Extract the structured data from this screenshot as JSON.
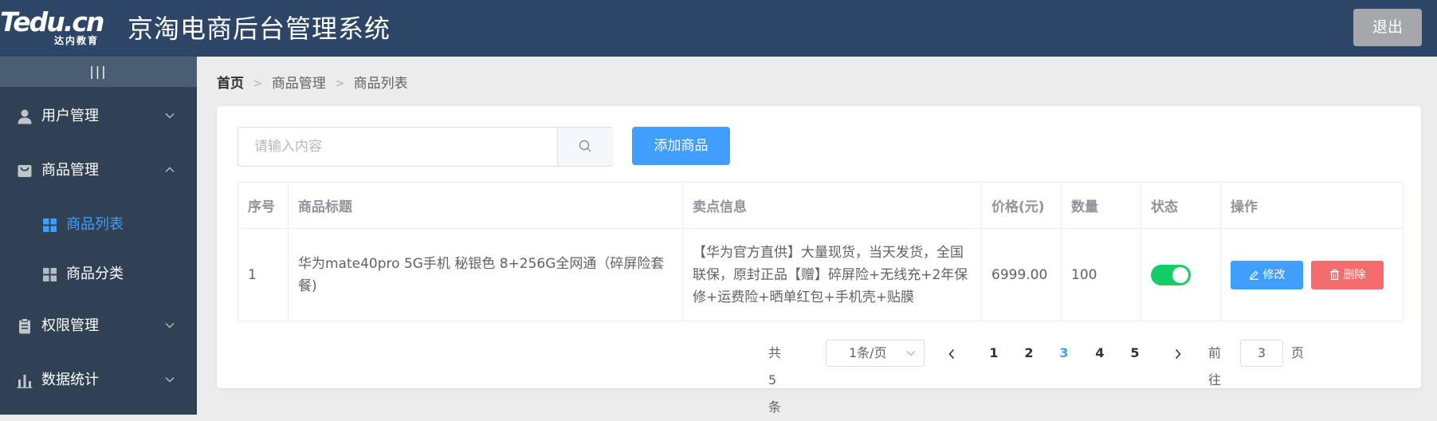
{
  "header": {
    "logo_main": "Tedu.cn",
    "logo_sub": "达内教育",
    "title": "京淘电商后台管理系统",
    "logout": "退出"
  },
  "sidebar": {
    "toggle": "|||",
    "active_color": "#409eff",
    "menus": [
      {
        "label": "用户管理",
        "icon": "user-icon",
        "expanded": false
      },
      {
        "label": "商品管理",
        "icon": "bag-icon",
        "expanded": true,
        "children": [
          {
            "label": "商品列表",
            "icon": "grid-icon",
            "active": true
          },
          {
            "label": "商品分类",
            "icon": "grid-icon",
            "active": false
          }
        ]
      },
      {
        "label": "权限管理",
        "icon": "clipboard-icon",
        "expanded": false
      },
      {
        "label": "数据统计",
        "icon": "bar-chart-icon",
        "expanded": false
      }
    ]
  },
  "breadcrumb": [
    "首页",
    "商品管理",
    "商品列表"
  ],
  "search": {
    "placeholder": "请输入内容",
    "value": ""
  },
  "add_button": "添加商品",
  "table": {
    "columns": [
      "序号",
      "商品标题",
      "卖点信息",
      "价格(元)",
      "数量",
      "状态",
      "操作"
    ],
    "rows": [
      {
        "index": "1",
        "title": "华为mate40pro 5G手机 秘银色 8+256G全网通（碎屏险套餐)",
        "selling_point": "【华为官方直供】大量现货，当天发货，全国联保，原封正品【赠】碎屏险+无线充+2年保修+运费险+晒单红包+手机壳+贴膜",
        "price": "6999.00",
        "quantity": "100",
        "status_on": true,
        "status_color": "#13ce66",
        "edit_label": "修改",
        "delete_label": "删除"
      }
    ]
  },
  "pagination": {
    "total_text": "共 5 条",
    "page_size": "1条/页",
    "pages": [
      "1",
      "2",
      "3",
      "4",
      "5"
    ],
    "current": "3",
    "goto_label": "前往",
    "goto_value": "3",
    "page_suffix": "页"
  },
  "colors": {
    "header_bg": "#2d4566",
    "sidebar_bg": "#2f4153",
    "primary": "#409eff",
    "danger": "#f56c6c",
    "success": "#13ce66"
  }
}
